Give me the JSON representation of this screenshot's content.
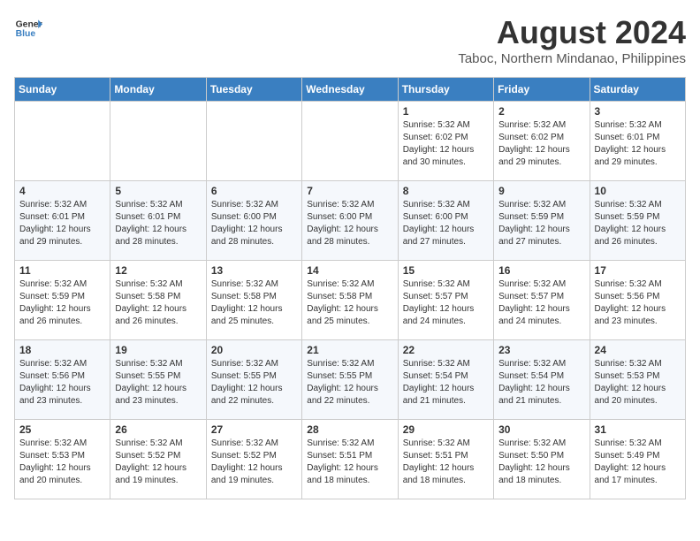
{
  "header": {
    "logo_line1": "General",
    "logo_line2": "Blue",
    "month": "August 2024",
    "location": "Taboc, Northern Mindanao, Philippines"
  },
  "days_of_week": [
    "Sunday",
    "Monday",
    "Tuesday",
    "Wednesday",
    "Thursday",
    "Friday",
    "Saturday"
  ],
  "weeks": [
    [
      {
        "day": "",
        "content": ""
      },
      {
        "day": "",
        "content": ""
      },
      {
        "day": "",
        "content": ""
      },
      {
        "day": "",
        "content": ""
      },
      {
        "day": "1",
        "content": "Sunrise: 5:32 AM\nSunset: 6:02 PM\nDaylight: 12 hours\nand 30 minutes."
      },
      {
        "day": "2",
        "content": "Sunrise: 5:32 AM\nSunset: 6:02 PM\nDaylight: 12 hours\nand 29 minutes."
      },
      {
        "day": "3",
        "content": "Sunrise: 5:32 AM\nSunset: 6:01 PM\nDaylight: 12 hours\nand 29 minutes."
      }
    ],
    [
      {
        "day": "4",
        "content": "Sunrise: 5:32 AM\nSunset: 6:01 PM\nDaylight: 12 hours\nand 29 minutes."
      },
      {
        "day": "5",
        "content": "Sunrise: 5:32 AM\nSunset: 6:01 PM\nDaylight: 12 hours\nand 28 minutes."
      },
      {
        "day": "6",
        "content": "Sunrise: 5:32 AM\nSunset: 6:00 PM\nDaylight: 12 hours\nand 28 minutes."
      },
      {
        "day": "7",
        "content": "Sunrise: 5:32 AM\nSunset: 6:00 PM\nDaylight: 12 hours\nand 28 minutes."
      },
      {
        "day": "8",
        "content": "Sunrise: 5:32 AM\nSunset: 6:00 PM\nDaylight: 12 hours\nand 27 minutes."
      },
      {
        "day": "9",
        "content": "Sunrise: 5:32 AM\nSunset: 5:59 PM\nDaylight: 12 hours\nand 27 minutes."
      },
      {
        "day": "10",
        "content": "Sunrise: 5:32 AM\nSunset: 5:59 PM\nDaylight: 12 hours\nand 26 minutes."
      }
    ],
    [
      {
        "day": "11",
        "content": "Sunrise: 5:32 AM\nSunset: 5:59 PM\nDaylight: 12 hours\nand 26 minutes."
      },
      {
        "day": "12",
        "content": "Sunrise: 5:32 AM\nSunset: 5:58 PM\nDaylight: 12 hours\nand 26 minutes."
      },
      {
        "day": "13",
        "content": "Sunrise: 5:32 AM\nSunset: 5:58 PM\nDaylight: 12 hours\nand 25 minutes."
      },
      {
        "day": "14",
        "content": "Sunrise: 5:32 AM\nSunset: 5:58 PM\nDaylight: 12 hours\nand 25 minutes."
      },
      {
        "day": "15",
        "content": "Sunrise: 5:32 AM\nSunset: 5:57 PM\nDaylight: 12 hours\nand 24 minutes."
      },
      {
        "day": "16",
        "content": "Sunrise: 5:32 AM\nSunset: 5:57 PM\nDaylight: 12 hours\nand 24 minutes."
      },
      {
        "day": "17",
        "content": "Sunrise: 5:32 AM\nSunset: 5:56 PM\nDaylight: 12 hours\nand 23 minutes."
      }
    ],
    [
      {
        "day": "18",
        "content": "Sunrise: 5:32 AM\nSunset: 5:56 PM\nDaylight: 12 hours\nand 23 minutes."
      },
      {
        "day": "19",
        "content": "Sunrise: 5:32 AM\nSunset: 5:55 PM\nDaylight: 12 hours\nand 23 minutes."
      },
      {
        "day": "20",
        "content": "Sunrise: 5:32 AM\nSunset: 5:55 PM\nDaylight: 12 hours\nand 22 minutes."
      },
      {
        "day": "21",
        "content": "Sunrise: 5:32 AM\nSunset: 5:55 PM\nDaylight: 12 hours\nand 22 minutes."
      },
      {
        "day": "22",
        "content": "Sunrise: 5:32 AM\nSunset: 5:54 PM\nDaylight: 12 hours\nand 21 minutes."
      },
      {
        "day": "23",
        "content": "Sunrise: 5:32 AM\nSunset: 5:54 PM\nDaylight: 12 hours\nand 21 minutes."
      },
      {
        "day": "24",
        "content": "Sunrise: 5:32 AM\nSunset: 5:53 PM\nDaylight: 12 hours\nand 20 minutes."
      }
    ],
    [
      {
        "day": "25",
        "content": "Sunrise: 5:32 AM\nSunset: 5:53 PM\nDaylight: 12 hours\nand 20 minutes."
      },
      {
        "day": "26",
        "content": "Sunrise: 5:32 AM\nSunset: 5:52 PM\nDaylight: 12 hours\nand 19 minutes."
      },
      {
        "day": "27",
        "content": "Sunrise: 5:32 AM\nSunset: 5:52 PM\nDaylight: 12 hours\nand 19 minutes."
      },
      {
        "day": "28",
        "content": "Sunrise: 5:32 AM\nSunset: 5:51 PM\nDaylight: 12 hours\nand 18 minutes."
      },
      {
        "day": "29",
        "content": "Sunrise: 5:32 AM\nSunset: 5:51 PM\nDaylight: 12 hours\nand 18 minutes."
      },
      {
        "day": "30",
        "content": "Sunrise: 5:32 AM\nSunset: 5:50 PM\nDaylight: 12 hours\nand 18 minutes."
      },
      {
        "day": "31",
        "content": "Sunrise: 5:32 AM\nSunset: 5:49 PM\nDaylight: 12 hours\nand 17 minutes."
      }
    ]
  ]
}
